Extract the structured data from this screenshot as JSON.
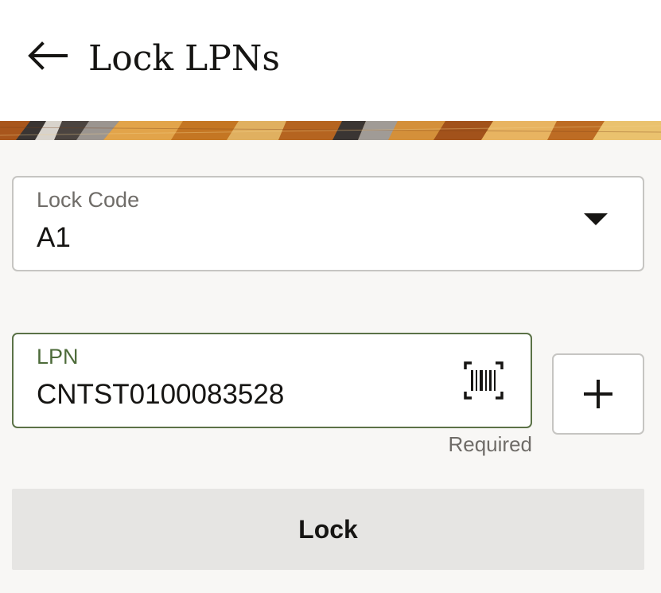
{
  "header": {
    "title": "Lock LPNs",
    "back_icon": "arrow-left-icon"
  },
  "form": {
    "lock_code": {
      "label": "Lock Code",
      "value": "A1",
      "icon": "dropdown-arrow-icon"
    },
    "lpn": {
      "label": "LPN",
      "value": "CNTST0100083528",
      "helper": "Required",
      "scan_icon": "barcode-scan-icon",
      "add_icon": "plus-icon"
    },
    "submit_label": "Lock"
  },
  "colors": {
    "header_bg": "#ffffff",
    "page_bg": "#f8f7f5",
    "focus_border": "#5b7247",
    "focus_label": "#4d6b3a",
    "button_bg": "#e6e5e3"
  }
}
